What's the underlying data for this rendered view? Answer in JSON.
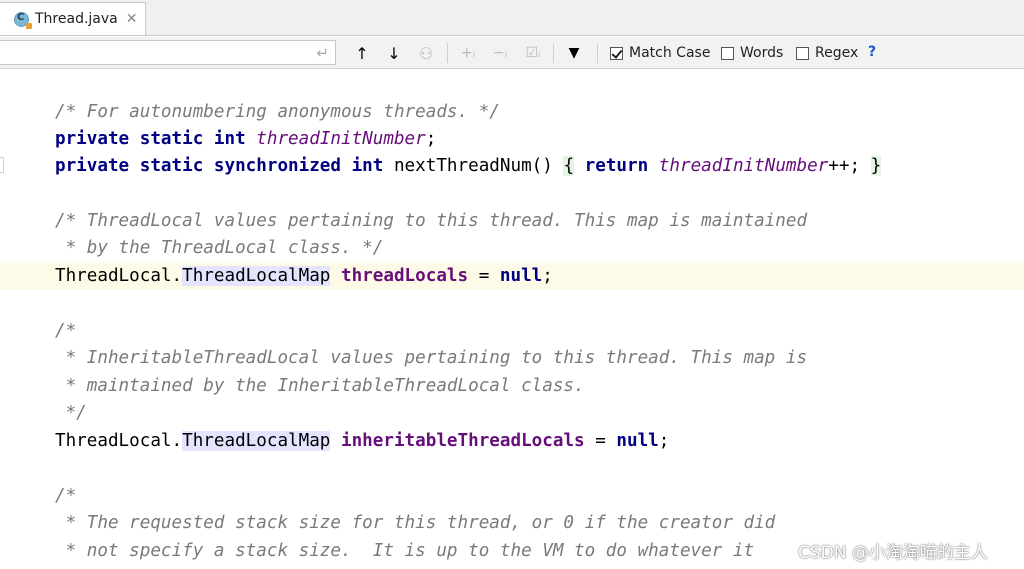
{
  "tabs": [
    {
      "label": "Thread.java",
      "icon": "java-class-icon",
      "close_icon": "close-icon"
    }
  ],
  "toolbar": {
    "search_value": "",
    "enter_icon": "↵",
    "buttons": [
      {
        "name": "previous-occurrence",
        "glyph": "↑",
        "enabled": true
      },
      {
        "name": "next-occurrence",
        "glyph": "↓",
        "enabled": true
      },
      {
        "name": "find-all",
        "glyph": "⚇",
        "enabled": false
      },
      {
        "name": "add-occurrence",
        "glyph": "+ᵢ",
        "enabled": false
      },
      {
        "name": "remove-occurrence",
        "glyph": "−ᵢ",
        "enabled": false
      },
      {
        "name": "select-all-occurrences",
        "glyph": "☑ᵢ",
        "enabled": false
      },
      {
        "name": "filter",
        "glyph": "▼",
        "enabled": true
      }
    ],
    "match_case": {
      "label": "Match Case",
      "checked": true
    },
    "words": {
      "label": "Words",
      "checked": false
    },
    "regex": {
      "label": "Regex",
      "checked": false
    },
    "help": "?"
  },
  "code": {
    "l1": "/* For autonumbering anonymous threads. */",
    "l2_kw": "private static int ",
    "l2_field": "threadInitNumber",
    "l2_end": ";",
    "l3_kw": "private static synchronized int ",
    "l3_name": "nextThreadNum() ",
    "l3_brace_open": "{",
    "l3_return": " return ",
    "l3_field": "threadInitNumber",
    "l3_rest": "++; ",
    "l3_brace_close": "}",
    "l5": "/* ThreadLocal values pertaining to this thread. This map is maintained",
    "l6": " * by the ThreadLocal class. */",
    "l7_type1": "ThreadLocal.",
    "l7_type2": "ThreadLocalMap",
    "l7_field": "threadLocals",
    "l7_eq": " = ",
    "l7_null": "null",
    "l7_end": ";",
    "l9": "/*",
    "l10": " * InheritableThreadLocal values pertaining to this thread. This map is",
    "l11": " * maintained by the InheritableThreadLocal class.",
    "l12": " */",
    "l13_type1": "ThreadLocal.",
    "l13_type2": "ThreadLocalMap",
    "l13_field": "inheritableThreadLocals",
    "l13_eq": " = ",
    "l13_null": "null",
    "l13_end": ";",
    "l15": "/*",
    "l16": " * The requested stack size for this thread, or 0 if the creator did",
    "l17": " * not specify a stack size.  It is up to the VM to do whatever it"
  },
  "watermark": "CSDN @小淘淘喵的主人",
  "colors": {
    "keyword": "#000080",
    "field": "#660e7a",
    "comment": "#7a7a7a",
    "caret_row": "#fdfbe8",
    "type_highlight": "#e4e4ff"
  }
}
